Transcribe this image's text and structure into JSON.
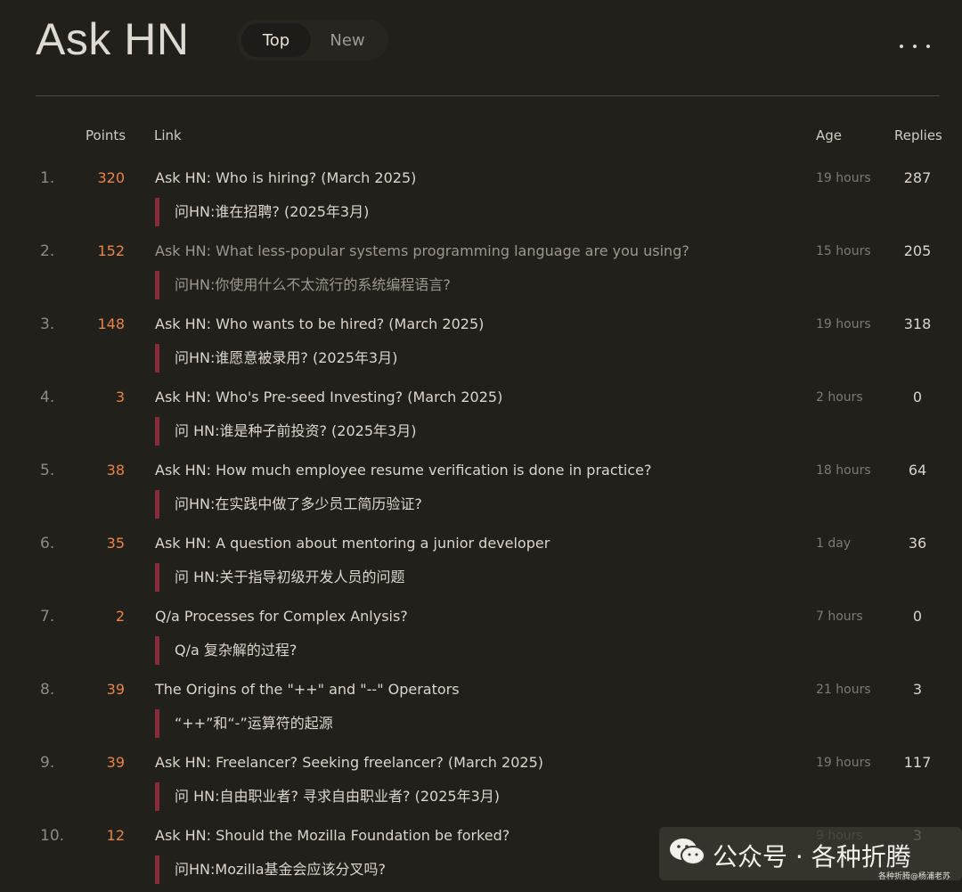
{
  "header": {
    "title": "Ask HN",
    "tabs": [
      {
        "label": "Top",
        "active": true
      },
      {
        "label": "New",
        "active": false
      }
    ],
    "more_icon": "more-horizontal-icon"
  },
  "columns": {
    "points": "Points",
    "link": "Link",
    "age": "Age",
    "replies": "Replies"
  },
  "rows": [
    {
      "rank": "1.",
      "points": "320",
      "title": "Ask HN: Who is hiring? (March 2025)",
      "translation": "问HN:谁在招聘? (2025年3月)",
      "age": "19 hours",
      "replies": "287"
    },
    {
      "rank": "2.",
      "points": "152",
      "title": "Ask HN: What less-popular systems programming language are you using?",
      "translation": "问HN:你使用什么不太流行的系统编程语言?",
      "age": "15 hours",
      "replies": "205"
    },
    {
      "rank": "3.",
      "points": "148",
      "title": "Ask HN: Who wants to be hired? (March 2025)",
      "translation": "问HN:谁愿意被录用? (2025年3月)",
      "age": "19 hours",
      "replies": "318"
    },
    {
      "rank": "4.",
      "points": "3",
      "title": "Ask HN: Who's Pre-seed Investing? (March 2025)",
      "translation": "问 HN:谁是种子前投资? (2025年3月)",
      "age": "2 hours",
      "replies": "0"
    },
    {
      "rank": "5.",
      "points": "38",
      "title": "Ask HN: How much employee resume verification is done in practice?",
      "translation": "问HN:在实践中做了多少员工简历验证?",
      "age": "18 hours",
      "replies": "64"
    },
    {
      "rank": "6.",
      "points": "35",
      "title": "Ask HN: A question about mentoring a junior developer",
      "translation": "问 HN:关于指导初级开发人员的问题",
      "age": "1 day",
      "replies": "36"
    },
    {
      "rank": "7.",
      "points": "2",
      "title": "Q/a Processes for Complex Anlysis?",
      "translation": "Q/a 复杂解的过程?",
      "age": "7 hours",
      "replies": "0"
    },
    {
      "rank": "8.",
      "points": "39",
      "title": "The Origins of the \"++\" and \"--\" Operators",
      "translation": "“++”和“-”运算符的起源",
      "age": "21 hours",
      "replies": "3"
    },
    {
      "rank": "9.",
      "points": "39",
      "title": "Ask HN: Freelancer? Seeking freelancer? (March 2025)",
      "translation": "问 HN:自由职业者? 寻求自由职业者? (2025年3月)",
      "age": "19 hours",
      "replies": "117"
    },
    {
      "rank": "10.",
      "points": "12",
      "title": "Ask HN: Should the Mozilla Foundation be forked?",
      "translation": "问HN:Mozilla基金会应该分叉吗?",
      "age": "9 hours",
      "replies": "3"
    }
  ],
  "watermark": {
    "text": "公众号 · 各种折腾",
    "sub": "各种折腾@杨浦老苏",
    "icon": "wechat-icon"
  }
}
